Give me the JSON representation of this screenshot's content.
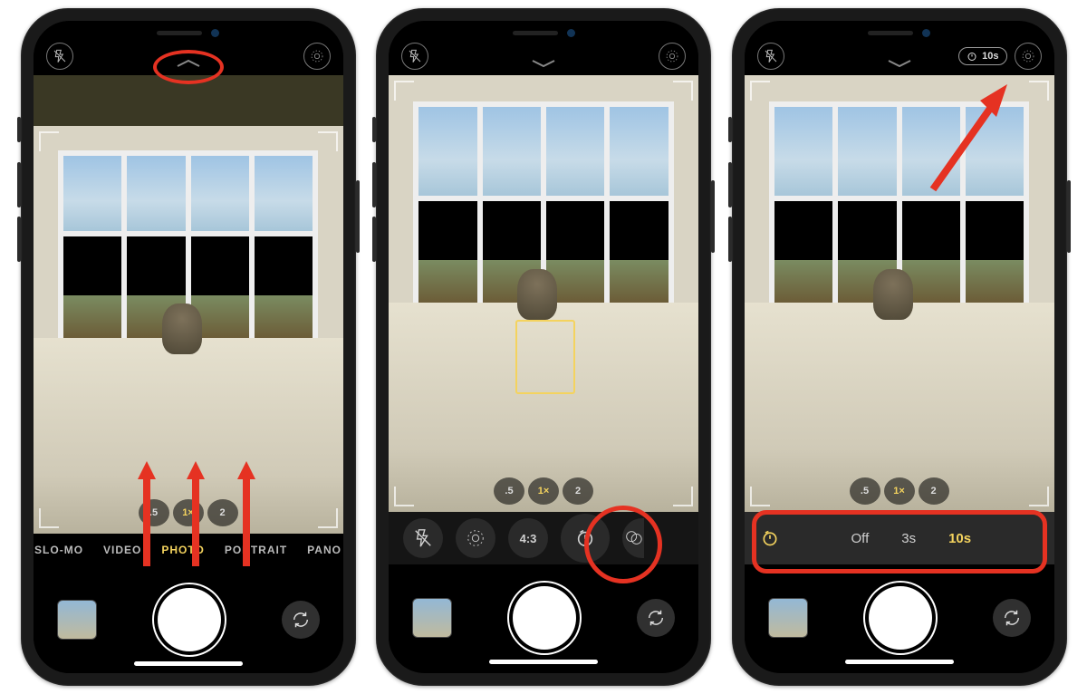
{
  "zoom": {
    "z05": ".5",
    "z1": "1×",
    "z2": "2"
  },
  "modes": [
    "SLO-MO",
    "VIDEO",
    "PHOTO",
    "PORTRAIT",
    "PANO"
  ],
  "selected_mode_index": 2,
  "screen2": {
    "aspect": "4:3"
  },
  "timer": {
    "badge": "10s",
    "options": {
      "off": "Off",
      "s3": "3s",
      "s10": "10s"
    },
    "selected": "10s"
  },
  "colors": {
    "accent": "#f4d35e",
    "annotation": "#e53222"
  }
}
